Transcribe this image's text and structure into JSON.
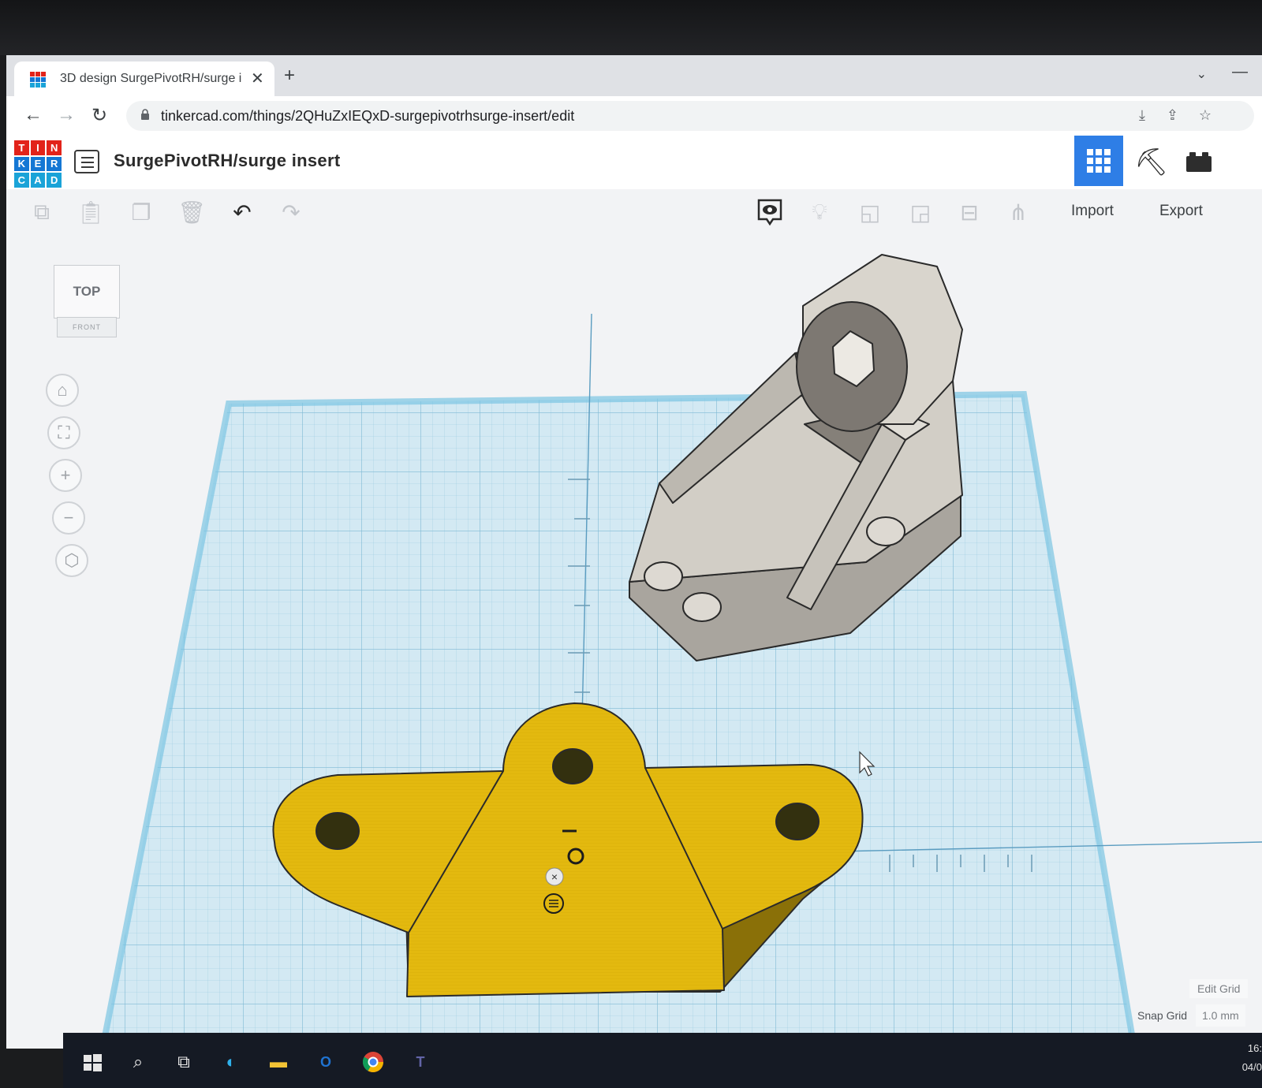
{
  "browser": {
    "tab_title": "3D design SurgePivotRH/surge insert",
    "tab_close_icon": "close-icon",
    "new_tab_label": "+",
    "url": "tinkercad.com/things/2QHuZxIEQxD-surgepivotrhsurge-insert/edit"
  },
  "app": {
    "logo_letters": [
      "T",
      "I",
      "N",
      "K",
      "E",
      "R",
      "C",
      "A",
      "D"
    ],
    "logo_colors": [
      "#e2231a",
      "#e2231a",
      "#e2231a",
      "#1477d4",
      "#1477d4",
      "#1477d4",
      "#1aa3d8",
      "#1aa3d8",
      "#1aa3d8"
    ],
    "design_title": "SurgePivotRH/surge insert",
    "accent_color": "#2e7ee6"
  },
  "toolbar": {
    "import_label": "Import",
    "export_label": "Export"
  },
  "viewcube": {
    "top_label": "TOP",
    "front_label": "FRONT"
  },
  "workplane": {
    "edit_grid_label": "Edit Grid",
    "snap_grid_label": "Snap Grid",
    "snap_grid_value": "1.0 mm",
    "gray_part_color": "#cdc9c1",
    "yellow_part_color": "#e3b90f"
  },
  "taskbar": {
    "clock_time": "16:",
    "clock_date": "04/0"
  }
}
